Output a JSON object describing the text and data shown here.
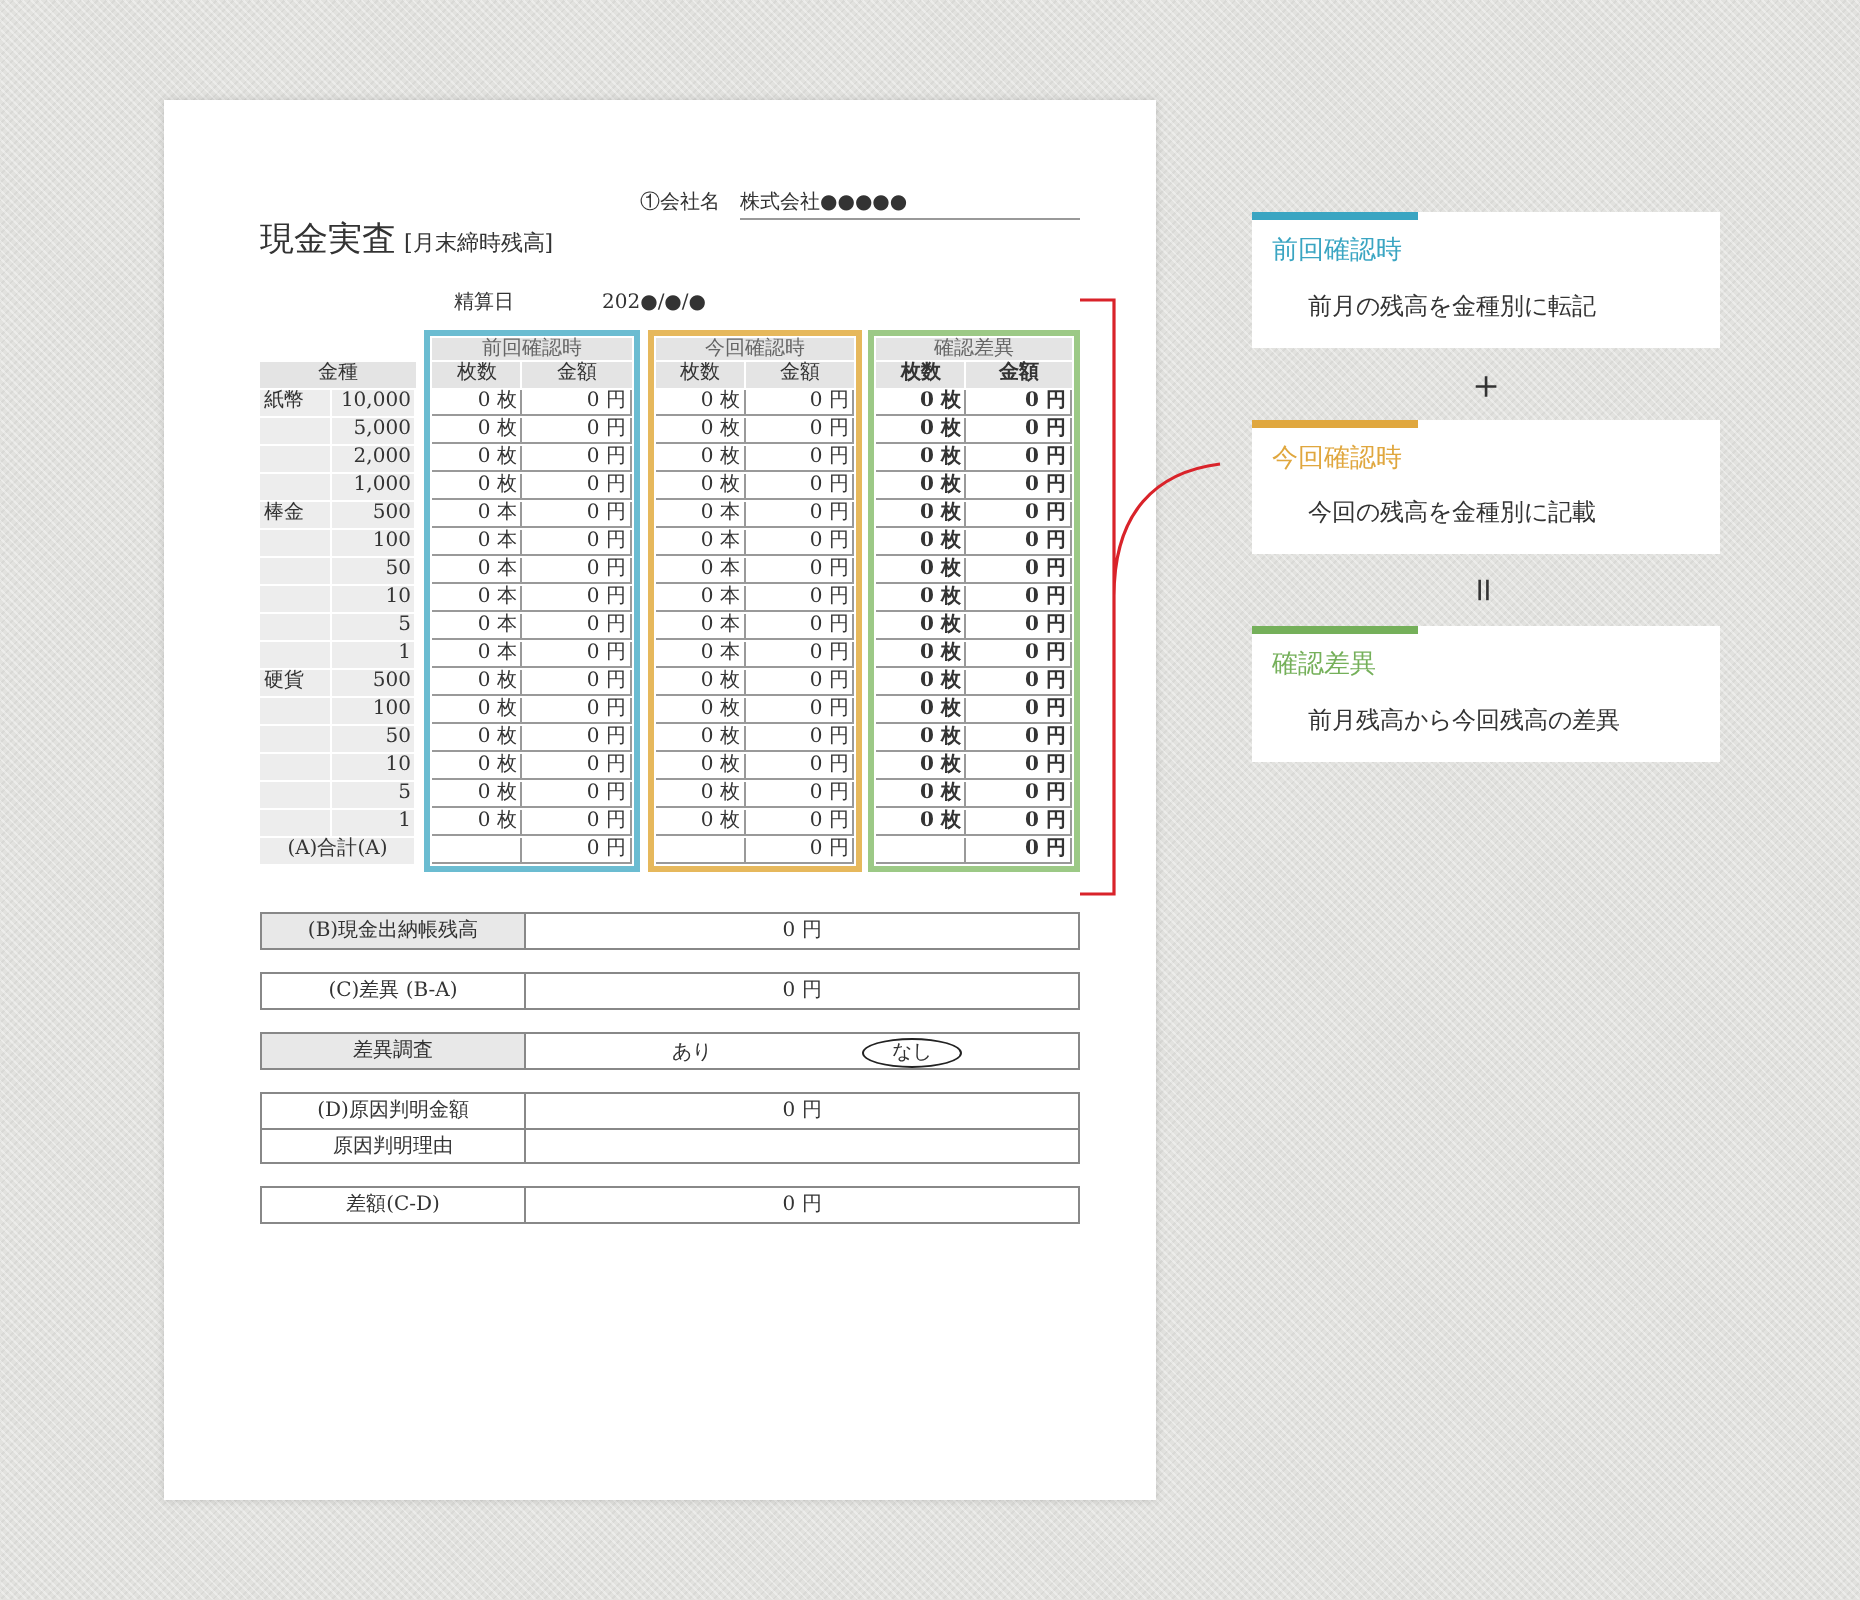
{
  "company": {
    "label": "①会社名",
    "value": "株式会社●●●●●"
  },
  "title": "現金実査",
  "subtitle": "[月末締時残高]",
  "settlement": {
    "label": "精算日",
    "value": "202●/●/●"
  },
  "denominations": {
    "header": "金種",
    "total_label": "(A)合計(A)",
    "rows": [
      {
        "type": "紙幣",
        "value": "10,000"
      },
      {
        "value": "5,000"
      },
      {
        "value": "2,000"
      },
      {
        "value": "1,000"
      },
      {
        "type": "棒金",
        "value": "500"
      },
      {
        "value": "100"
      },
      {
        "value": "50"
      },
      {
        "value": "10"
      },
      {
        "value": "5"
      },
      {
        "value": "1"
      },
      {
        "type": "硬貨",
        "value": "500"
      },
      {
        "value": "100"
      },
      {
        "value": "50"
      },
      {
        "value": "10"
      },
      {
        "value": "5"
      },
      {
        "value": "1"
      }
    ]
  },
  "groups": [
    {
      "title": "前回確認時",
      "color": "#6bbcd1",
      "emphasis": false,
      "columns": [
        "枚数",
        "金額"
      ],
      "counts": [
        "0 枚",
        "0 枚",
        "0 枚",
        "0 枚",
        "0 本",
        "0 本",
        "0 本",
        "0 本",
        "0 本",
        "0 本",
        "0 枚",
        "0 枚",
        "0 枚",
        "0 枚",
        "0 枚",
        "0 枚"
      ],
      "amounts": [
        "0 円",
        "0 円",
        "0 円",
        "0 円",
        "0 円",
        "0 円",
        "0 円",
        "0 円",
        "0 円",
        "0 円",
        "0 円",
        "0 円",
        "0 円",
        "0 円",
        "0 円",
        "0 円"
      ],
      "total": "0 円"
    },
    {
      "title": "今回確認時",
      "color": "#e6b85c",
      "emphasis": false,
      "columns": [
        "枚数",
        "金額"
      ],
      "counts": [
        "0 枚",
        "0 枚",
        "0 枚",
        "0 枚",
        "0 本",
        "0 本",
        "0 本",
        "0 本",
        "0 本",
        "0 本",
        "0 枚",
        "0 枚",
        "0 枚",
        "0 枚",
        "0 枚",
        "0 枚"
      ],
      "amounts": [
        "0 円",
        "0 円",
        "0 円",
        "0 円",
        "0 円",
        "0 円",
        "0 円",
        "0 円",
        "0 円",
        "0 円",
        "0 円",
        "0 円",
        "0 円",
        "0 円",
        "0 円",
        "0 円"
      ],
      "total": "0 円"
    },
    {
      "title": "確認差異",
      "color": "#9cc986",
      "emphasis": true,
      "columns": [
        "枚数",
        "金額"
      ],
      "counts": [
        "0 枚",
        "0 枚",
        "0 枚",
        "0 枚",
        "0 枚",
        "0 枚",
        "0 枚",
        "0 枚",
        "0 枚",
        "0 枚",
        "0 枚",
        "0 枚",
        "0 枚",
        "0 枚",
        "0 枚",
        "0 枚"
      ],
      "amounts": [
        "0 円",
        "0 円",
        "0 円",
        "0 円",
        "0 円",
        "0 円",
        "0 円",
        "0 円",
        "0 円",
        "0 円",
        "0 円",
        "0 円",
        "0 円",
        "0 円",
        "0 円",
        "0 円"
      ],
      "total": "0 円"
    }
  ],
  "summary": [
    [
      {
        "kind": "value",
        "label": "(B)現金出納帳残高",
        "shaded": true,
        "value": "0 円"
      }
    ],
    [
      {
        "kind": "value",
        "label": "(C)差異 (B-A)",
        "shaded": false,
        "value": "0 円"
      }
    ],
    [
      {
        "kind": "choice",
        "label": "差異調査",
        "shaded": true,
        "options": [
          {
            "text": "あり",
            "selected": false
          },
          {
            "text": "なし",
            "selected": true
          }
        ]
      }
    ],
    [
      {
        "kind": "value",
        "label": "(D)原因判明金額",
        "shaded": false,
        "value": "0 円"
      },
      {
        "kind": "blank",
        "label": "原因判明理由",
        "shaded": false
      }
    ],
    [
      {
        "kind": "value",
        "label": "差額(C-D)",
        "shaded": false,
        "value": "0 円"
      }
    ]
  ],
  "notes": [
    {
      "title": "前回確認時",
      "description": "前月の残高を金種別に転記",
      "color": "#3aa5c2"
    },
    {
      "operator": "＋",
      "title": "今回確認時",
      "description": "今回の残高を金種別に記載",
      "color": "#e0a73e"
    },
    {
      "operator": "＝",
      "title": "確認差異",
      "description": "前月残高から今回残高の差異",
      "color": "#75b05a"
    }
  ]
}
